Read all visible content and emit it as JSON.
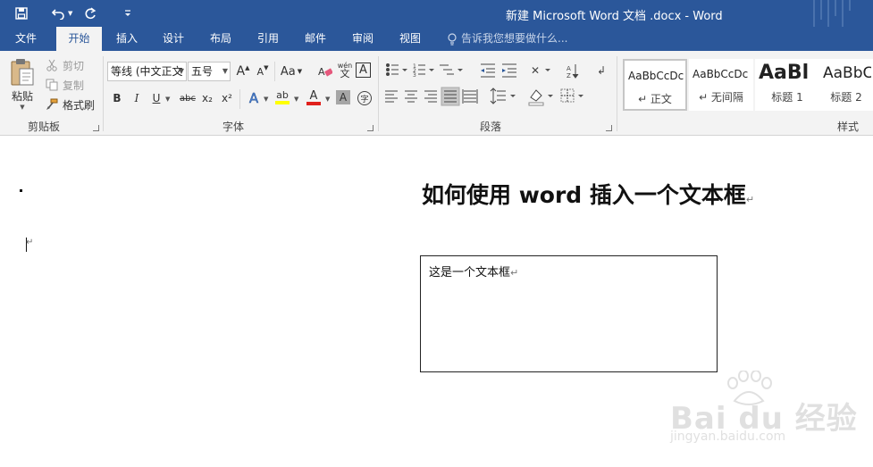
{
  "window": {
    "title": "新建 Microsoft Word 文档 .docx - Word"
  },
  "quick_access": {
    "icons": [
      "save-icon",
      "undo-icon",
      "redo-icon",
      "customize-icon"
    ]
  },
  "ribbon_tabs": [
    {
      "label": "文件",
      "active": false
    },
    {
      "label": "开始",
      "active": true
    },
    {
      "label": "插入",
      "active": false
    },
    {
      "label": "设计",
      "active": false
    },
    {
      "label": "布局",
      "active": false
    },
    {
      "label": "引用",
      "active": false
    },
    {
      "label": "邮件",
      "active": false
    },
    {
      "label": "审阅",
      "active": false
    },
    {
      "label": "视图",
      "active": false
    }
  ],
  "tell_me": {
    "placeholder": "告诉我您想要做什么..."
  },
  "clipboard": {
    "group_label": "剪贴板",
    "paste_label": "粘贴",
    "cut_label": "剪切",
    "copy_label": "复制",
    "format_painter_label": "格式刷"
  },
  "font": {
    "group_label": "字体",
    "font_name": "等线 (中文正文",
    "font_size": "五号",
    "case_label": "Aa",
    "bold": "B",
    "italic": "I",
    "underline": "U",
    "strikethrough": "abc",
    "subscript": "x₂",
    "superscript": "x²",
    "grow_font": "A",
    "shrink_font": "A",
    "phonetic_top": "wén",
    "phonetic_bottom": "文",
    "char_border": "A",
    "text_effect": "A",
    "highlight": "ab",
    "font_color": "A",
    "char_shading": "A",
    "enclose": "字"
  },
  "paragraph": {
    "group_label": "段落"
  },
  "styles": {
    "group_label": "样式",
    "items": [
      {
        "sample": "AaBbCcDc",
        "name": "↵ 正文",
        "selected": true
      },
      {
        "sample": "AaBbCcDc",
        "name": "↵ 无间隔",
        "selected": false
      },
      {
        "sample": "AaBl",
        "name": "标题 1",
        "selected": false
      },
      {
        "sample": "AaBbC",
        "name": "标题 2",
        "selected": false
      }
    ]
  },
  "document": {
    "heading": "如何使用 word 插入一个文本框",
    "heading_mark": "↵",
    "empty_para_mark": "↵",
    "textbox_text": "这是一个文本框",
    "textbox_mark": "↵"
  },
  "watermark": {
    "brand": "Bai du 经验",
    "url": "jingyan.baidu.com"
  },
  "colors": {
    "ribbon_blue": "#2b579a",
    "ribbon_bg": "#f3f3f3",
    "font_color_red": "#e0201c",
    "highlight_yellow": "#ffff00"
  }
}
